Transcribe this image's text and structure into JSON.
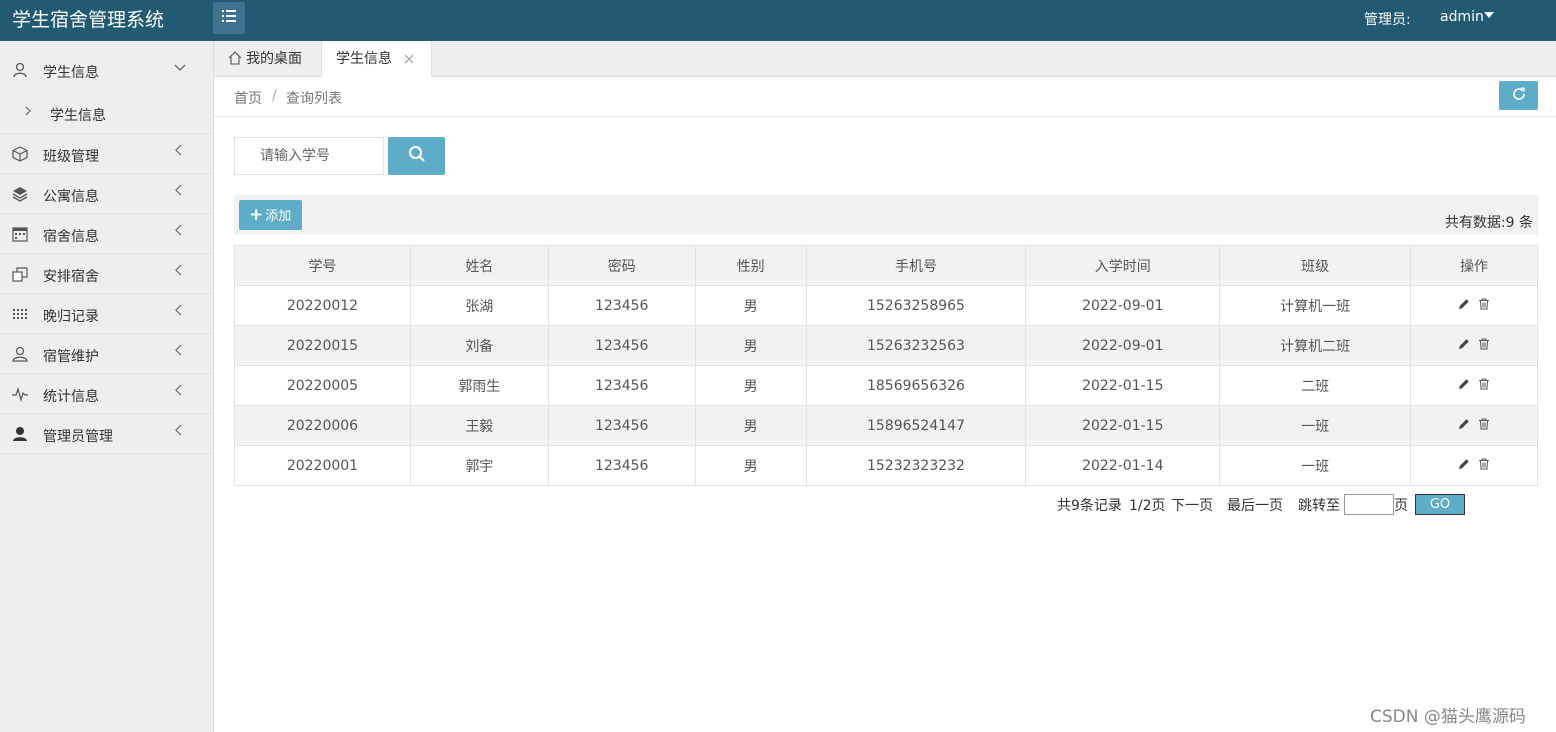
{
  "header": {
    "title": "学生宿舍管理系统",
    "admin_label": "管理员:",
    "admin_name": "admin"
  },
  "sidebar": {
    "items": [
      {
        "label": "学生信息",
        "icon": "user-icon"
      },
      {
        "label": "班级管理",
        "icon": "cube-icon"
      },
      {
        "label": "公寓信息",
        "icon": "layers-icon"
      },
      {
        "label": "宿舍信息",
        "icon": "calendar-icon"
      },
      {
        "label": "安排宿舍",
        "icon": "copy-icon"
      },
      {
        "label": "晚归记录",
        "icon": "grid-icon"
      },
      {
        "label": "宿管维护",
        "icon": "person-icon"
      },
      {
        "label": "统计信息",
        "icon": "pulse-icon"
      },
      {
        "label": "管理员管理",
        "icon": "user-solid-icon"
      }
    ],
    "sub_item": "学生信息"
  },
  "tabs": {
    "home": "我的桌面",
    "active": "学生信息"
  },
  "breadcrumb": {
    "home": "首页",
    "sep": "/",
    "current": "查询列表"
  },
  "search": {
    "placeholder": "请输入学号"
  },
  "toolbar": {
    "add_label": "添加",
    "total": "共有数据:9 条"
  },
  "table": {
    "headers": [
      "学号",
      "姓名",
      "密码",
      "性别",
      "手机号",
      "入学时间",
      "班级",
      "操作"
    ],
    "rows": [
      [
        "20220012",
        "张湖",
        "123456",
        "男",
        "15263258965",
        "2022-09-01",
        "计算机一班"
      ],
      [
        "20220015",
        "刘备",
        "123456",
        "男",
        "15263232563",
        "2022-09-01",
        "计算机二班"
      ],
      [
        "20220005",
        "郭雨生",
        "123456",
        "男",
        "18569656326",
        "2022-01-15",
        "二班"
      ],
      [
        "20220006",
        "王毅",
        "123456",
        "男",
        "15896524147",
        "2022-01-15",
        "一班"
      ],
      [
        "20220001",
        "郭宇",
        "123456",
        "男",
        "15232323232",
        "2022-01-14",
        "一班"
      ]
    ]
  },
  "pager": {
    "records": "共9条记录",
    "page": "1/2页",
    "next": "下一页",
    "last": "最后一页",
    "jump_to": "跳转至",
    "page_unit": "页",
    "go": "GO"
  },
  "watermark": "CSDN @猫头鹰源码",
  "colors": {
    "header_bg": "#225a74",
    "accent": "#5eacc8",
    "sidebar_bg": "#eeeeee"
  }
}
